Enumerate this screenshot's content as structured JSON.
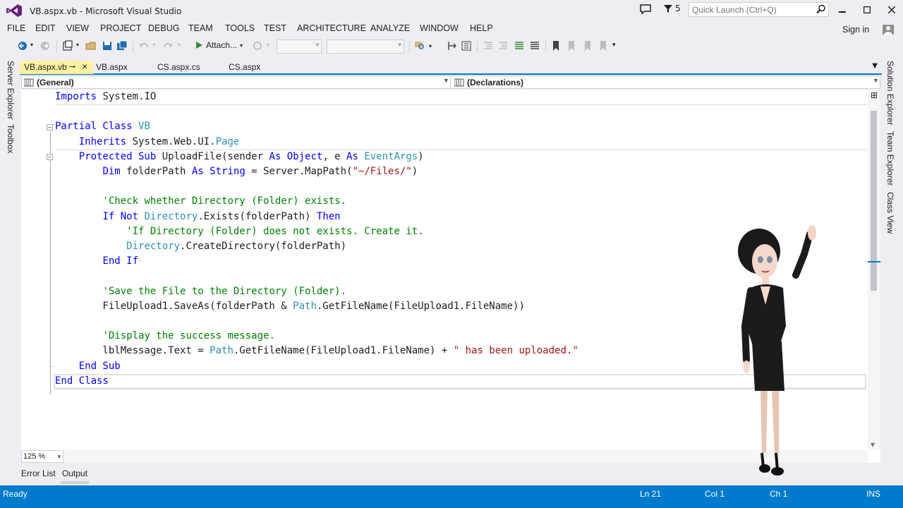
{
  "window": {
    "title": "VB.aspx.vb - Microsoft Visual Studio",
    "notification_count": "5",
    "quick_launch_placeholder": "Quick Launch (Ctrl+Q)"
  },
  "menu": {
    "items": [
      "FILE",
      "EDIT",
      "VIEW",
      "PROJECT",
      "DEBUG",
      "TEAM",
      "TOOLS",
      "TEST",
      "ARCHITECTURE",
      "ANALYZE",
      "WINDOW",
      "HELP"
    ],
    "sign_in": "Sign in"
  },
  "toolbar": {
    "attach_label": "Attach..."
  },
  "left_tool_windows": [
    "Server Explorer",
    "Toolbox"
  ],
  "right_tool_windows": [
    "Solution Explorer",
    "Team Explorer",
    "Class View"
  ],
  "doc_tabs": [
    {
      "label": "VB.aspx.vb",
      "active": true
    },
    {
      "label": "VB.aspx",
      "active": false
    },
    {
      "label": "CS.aspx.cs",
      "active": false
    },
    {
      "label": "CS.aspx",
      "active": false
    }
  ],
  "navbar": {
    "left": "(General)",
    "right": "(Declarations)"
  },
  "editor": {
    "zoom": "125 %",
    "lines": [
      [
        {
          "t": "kw",
          "s": "Imports"
        },
        {
          "t": "pl",
          "s": " System.IO"
        }
      ],
      [],
      [
        {
          "t": "kw",
          "s": "Partial Class"
        },
        {
          "t": "pl",
          "s": " "
        },
        {
          "t": "ty",
          "s": "VB"
        }
      ],
      [
        {
          "t": "pl",
          "s": "    "
        },
        {
          "t": "kw",
          "s": "Inherits"
        },
        {
          "t": "pl",
          "s": " System.Web.UI."
        },
        {
          "t": "ty",
          "s": "Page"
        }
      ],
      [
        {
          "t": "pl",
          "s": "    "
        },
        {
          "t": "kw",
          "s": "Protected Sub"
        },
        {
          "t": "pl",
          "s": " UploadFile(sender "
        },
        {
          "t": "kw",
          "s": "As Object"
        },
        {
          "t": "pl",
          "s": ", e "
        },
        {
          "t": "kw",
          "s": "As"
        },
        {
          "t": "pl",
          "s": " "
        },
        {
          "t": "ty",
          "s": "EventArgs"
        },
        {
          "t": "pl",
          "s": ")"
        }
      ],
      [
        {
          "t": "pl",
          "s": "        "
        },
        {
          "t": "kw",
          "s": "Dim"
        },
        {
          "t": "pl",
          "s": " folderPath "
        },
        {
          "t": "kw",
          "s": "As String"
        },
        {
          "t": "pl",
          "s": " = Server.MapPath("
        },
        {
          "t": "st",
          "s": "\"~/Files/\""
        },
        {
          "t": "pl",
          "s": ")"
        }
      ],
      [],
      [
        {
          "t": "pl",
          "s": "        "
        },
        {
          "t": "cm",
          "s": "'Check whether Directory (Folder) exists."
        }
      ],
      [
        {
          "t": "pl",
          "s": "        "
        },
        {
          "t": "kw",
          "s": "If Not"
        },
        {
          "t": "pl",
          "s": " "
        },
        {
          "t": "ty",
          "s": "Directory"
        },
        {
          "t": "pl",
          "s": ".Exists(folderPath) "
        },
        {
          "t": "kw",
          "s": "Then"
        }
      ],
      [
        {
          "t": "pl",
          "s": "            "
        },
        {
          "t": "cm",
          "s": "'If Directory (Folder) does not exists. Create it."
        }
      ],
      [
        {
          "t": "pl",
          "s": "            "
        },
        {
          "t": "ty",
          "s": "Directory"
        },
        {
          "t": "pl",
          "s": ".CreateDirectory(folderPath)"
        }
      ],
      [
        {
          "t": "pl",
          "s": "        "
        },
        {
          "t": "kw",
          "s": "End If"
        }
      ],
      [],
      [
        {
          "t": "pl",
          "s": "        "
        },
        {
          "t": "cm",
          "s": "'Save the File to the Directory (Folder)."
        }
      ],
      [
        {
          "t": "pl",
          "s": "        FileUpload1.SaveAs(folderPath & "
        },
        {
          "t": "ty",
          "s": "Path"
        },
        {
          "t": "pl",
          "s": ".GetFileName(FileUpload1.FileName))"
        }
      ],
      [],
      [
        {
          "t": "pl",
          "s": "        "
        },
        {
          "t": "cm",
          "s": "'Display the success message."
        }
      ],
      [
        {
          "t": "pl",
          "s": "        lblMessage.Text = "
        },
        {
          "t": "ty",
          "s": "Path"
        },
        {
          "t": "pl",
          "s": ".GetFileName(FileUpload1.FileName) + "
        },
        {
          "t": "st",
          "s": "\" has been uploaded.\""
        }
      ],
      [
        {
          "t": "pl",
          "s": "    "
        },
        {
          "t": "kw",
          "s": "End Sub"
        }
      ],
      [
        {
          "t": "kw",
          "s": "End Class"
        }
      ]
    ]
  },
  "bottom_tabs": [
    "Error List",
    "Output"
  ],
  "status": {
    "ready": "Ready",
    "ln": "Ln 21",
    "col": "Col 1",
    "ch": "Ch 1",
    "mode": "INS"
  },
  "colors": {
    "accent": "#007acc",
    "keyword": "#0000ff",
    "type": "#2b91af",
    "comment": "#008000",
    "string": "#a31515",
    "active_tab": "#fff1a3"
  }
}
